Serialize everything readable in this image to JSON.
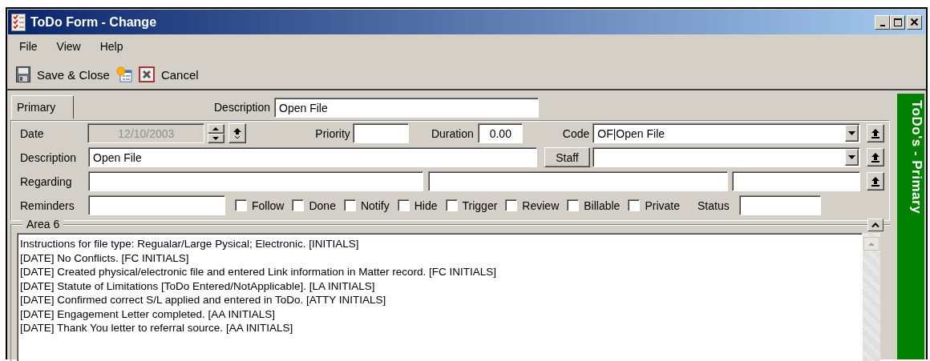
{
  "window": {
    "title": "ToDo Form - Change"
  },
  "menu": [
    {
      "label": "File"
    },
    {
      "label": "View"
    },
    {
      "label": "Help"
    }
  ],
  "toolbar": [
    {
      "kind": "save",
      "label": "Save & Close"
    },
    {
      "kind": "new"
    },
    {
      "kind": "cancel",
      "label": "Cancel"
    }
  ],
  "tabs": [
    {
      "label": "Primary",
      "selected": true
    }
  ],
  "header": {
    "label": "Description",
    "value": "Open File"
  },
  "form": {
    "date": {
      "label": "Date",
      "value": "12/10/2003",
      "disabled": true
    },
    "priority": {
      "label": "Priority"
    },
    "duration": {
      "label": "Duration",
      "value": "0.00"
    },
    "code": {
      "label": "Code",
      "value": "OF|Open File"
    },
    "description": {
      "label": "Description",
      "value": "Open File"
    },
    "staff": {
      "button": "Staff"
    },
    "regarding": {
      "label": "Regarding"
    },
    "reminders": {
      "label": "Reminders"
    },
    "checkboxes": [
      {
        "label": "Follow",
        "checked": false
      },
      {
        "label": "Done",
        "checked": false
      },
      {
        "label": "Notify",
        "checked": false
      },
      {
        "label": "Hide",
        "checked": false
      },
      {
        "label": "Trigger",
        "checked": false
      },
      {
        "label": "Review",
        "checked": false
      },
      {
        "label": "Billable",
        "checked": false
      },
      {
        "label": "Private",
        "checked": false
      }
    ],
    "status": {
      "label": "Status"
    }
  },
  "area": {
    "title": "Area 6",
    "lines": [
      "Instructions for file type:  Regualar/Large Pysical; Electronic. [INITIALS]",
      "[DATE] No Conflicts. [FC INITIALS]",
      "[DATE] Created physical/electronic file and entered Link information in Matter record. [FC INITIALS]",
      "[DATE] Statute of Limitations [ToDo Entered/NotApplicable]. [LA INITIALS]",
      "[DATE] Confirmed correct S/L applied and entered in ToDo. [ATTY INITIALS]",
      "[DATE] Engagement Letter completed. [AA INITIALS]",
      "[DATE] Thank You letter to referral source. [AA INITIALS]"
    ]
  },
  "side_panel": {
    "title": "ToDo's - Primary"
  }
}
